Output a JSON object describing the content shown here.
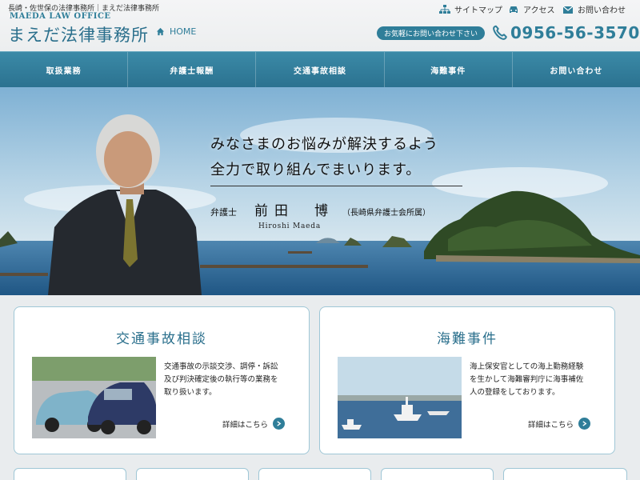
{
  "header": {
    "tagline": "長崎・佐世保の法律事務所｜まえだ法律事務所",
    "english_name": "MAEDA LAW OFFICE",
    "site_title": "まえだ法律事務所",
    "home_label": "HOME",
    "sitemap_label": "サイトマップ",
    "access_label": "アクセス",
    "inquiry_label": "お問い合わせ",
    "contact_pill": "お気軽にお問い合わせ下さい",
    "phone": "0956-56-3570"
  },
  "nav": {
    "items": [
      {
        "label": "取扱業務"
      },
      {
        "label": "弁護士報酬"
      },
      {
        "label": "交通事故相談"
      },
      {
        "label": "海難事件"
      },
      {
        "label": "お問い合わせ"
      }
    ]
  },
  "hero": {
    "catch_line1": "みなさまのお悩みが解決するよう",
    "catch_line2": "全力で取り組んでまいります。",
    "lawyer_title": "弁護士",
    "lawyer_name": "前田　博",
    "lawyer_association": "（長崎県弁護士会所属）",
    "lawyer_roman": "Hiroshi Maeda"
  },
  "cards": [
    {
      "title": "交通事故相談",
      "lines": [
        "交通事故の示談交渉、調停・訴訟",
        "及び判決確定後の執行等の業務を",
        "取り扱います。"
      ],
      "more": "詳細はこちら"
    },
    {
      "title": "海難事件",
      "lines": [
        "海上保安官としての海上勤務経験",
        "を生かして海難審判庁に海事補佐",
        "人の登録をしております。"
      ],
      "more": "詳細はこちら"
    }
  ],
  "colors": {
    "accent": "#2f7e99",
    "nav_bg": "#2b7290",
    "card_border": "#9fc7d6"
  },
  "icons": [
    "home-icon",
    "sitemap-icon",
    "car-icon",
    "mail-icon",
    "phone-icon",
    "arrow-right-icon"
  ]
}
